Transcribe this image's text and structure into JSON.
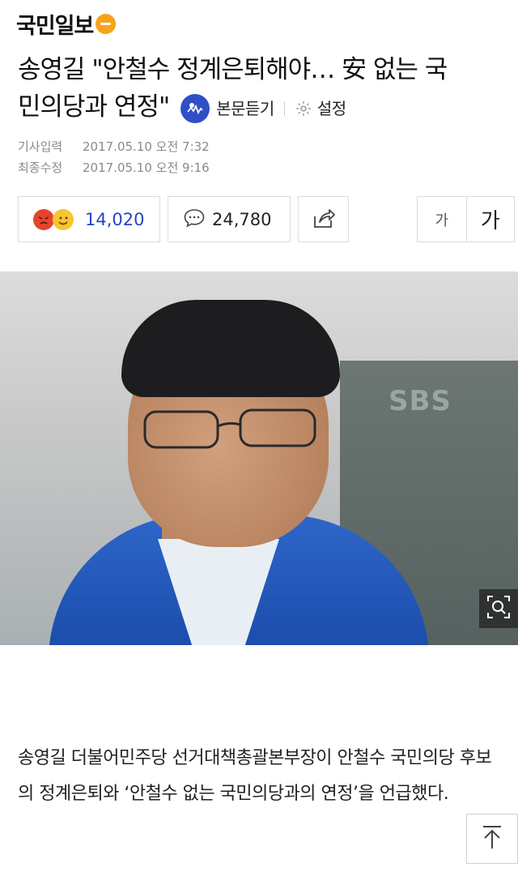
{
  "header": {
    "logo_text": "국민일보",
    "logo_icon": "smile-circle-icon",
    "brand_color": "#f6a31a"
  },
  "article": {
    "title_line1": "송영길 \"안철수 정계은퇴해야… 安 없는 국",
    "title_line2": "민의당과 연정\"",
    "listen_label": "본문듣기",
    "settings_label": "설정",
    "meta": {
      "published_label": "기사입력",
      "published_value": "2017.05.10 오전 7:32",
      "modified_label": "최종수정",
      "modified_value": "2017.05.10 오전 9:16"
    },
    "body": "송영길 더불어민주당 선거대책총괄본부장이 안철수 국민의당 후보의 정계은퇴와 ‘안철수 없는 국민의당과의 연정’을 언급했다."
  },
  "actions": {
    "reaction_count": "14,020",
    "comment_count": "24,780",
    "font_small": "가",
    "font_large": "가",
    "accent_color": "#2446c5"
  },
  "photo": {
    "background_sign": "SBS"
  }
}
